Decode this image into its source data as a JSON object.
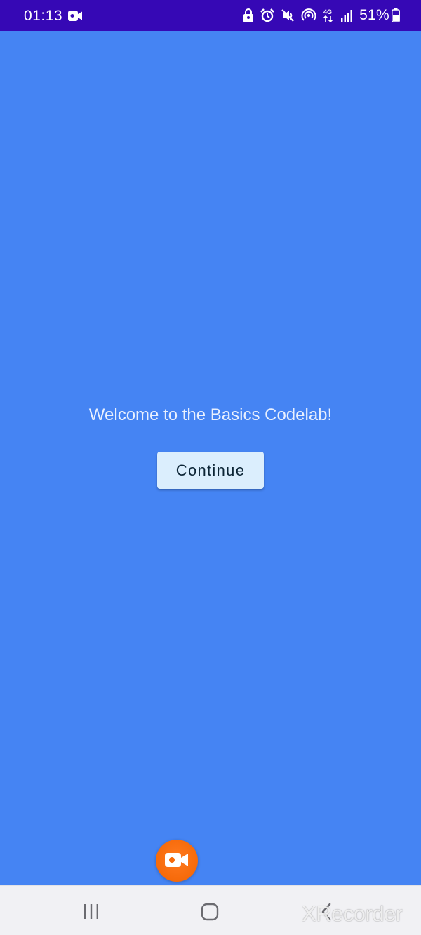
{
  "status_bar": {
    "time": "01:13",
    "battery_percent": "51%",
    "network_label": "4G",
    "icons": [
      "video-record-icon",
      "lock-icon",
      "alarm-icon",
      "mute-icon",
      "hotspot-icon",
      "network-4g-icon",
      "signal-icon",
      "battery-icon"
    ]
  },
  "main": {
    "welcome_text": "Welcome to the Basics Codelab!",
    "continue_label": "Continue"
  },
  "recorder": {
    "icon": "video-camera-icon"
  },
  "nav_bar": {
    "recents_icon": "recents-icon",
    "home_icon": "home-icon",
    "back_icon": "back-icon",
    "watermark": "XRecorder"
  },
  "colors": {
    "background": "#4584f3",
    "status_bar": "#3608b5",
    "button_bg": "#dbeefd",
    "recorder_orange": "#f66a0a"
  }
}
